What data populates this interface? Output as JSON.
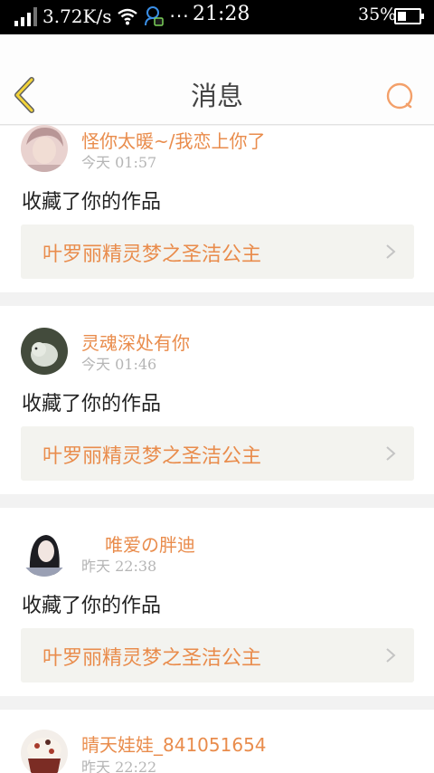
{
  "status_bar": {
    "network_speed": "3.72K/s",
    "more": "···",
    "time": "21:28",
    "battery_percent": "35%",
    "battery_level": 0.35
  },
  "header": {
    "title": "消息",
    "accent_color": "#e98c4c",
    "back_icon": "chevron-left-icon",
    "search_icon": "search-icon"
  },
  "messages": [
    {
      "username": "怪你太暖~/我恋上你了",
      "time": "今天 01:57",
      "action": "收藏了你的作品",
      "work_title": "叶罗丽精灵梦之圣洁公主"
    },
    {
      "username": "灵魂深处有你",
      "time": "今天 01:46",
      "action": "收藏了你的作品",
      "work_title": "叶罗丽精灵梦之圣洁公主"
    },
    {
      "username": "唯爱の胖迪",
      "time": "昨天 22:38",
      "action": "收藏了你的作品",
      "work_title": "叶罗丽精灵梦之圣洁公主"
    },
    {
      "username": "晴天娃娃_841051654",
      "time": "昨天 22:22"
    }
  ]
}
